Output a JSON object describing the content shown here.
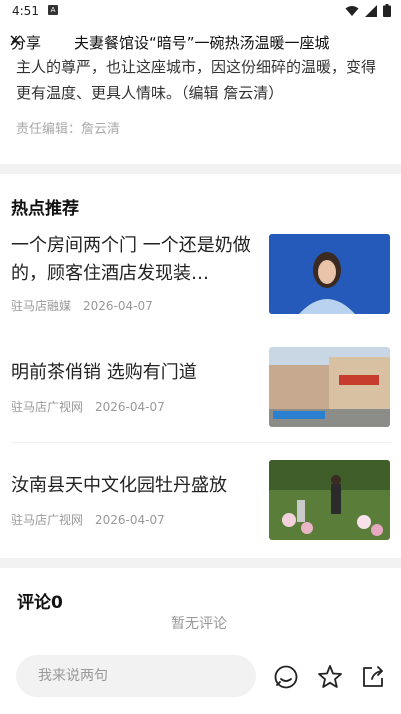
{
  "status": {
    "time": "4:51",
    "a_label": "A"
  },
  "header": {
    "share_label": "分享",
    "close_glyph": "×",
    "title": "夫妻餐馆设“暗号”一碗热汤温暖一座城"
  },
  "article": {
    "tail_line1": "主人的尊严，也让这座城市，因这份细碎的温暖，变得",
    "tail_line2": "更有温度、更具人情味。（编辑 詹云清）",
    "editor": "责任编辑：詹云清"
  },
  "hot": {
    "title": "热点推荐",
    "items": [
      {
        "title": "一个房间两个门 一个还是奶做的，顾客住酒店发现装…",
        "source": "驻马店融媒",
        "date": "2026-04-07"
      },
      {
        "title": "明前茶俏销 选购有门道",
        "source": "驻马店广视网",
        "date": "2026-04-07"
      },
      {
        "title": "汝南县天中文化园牡丹盛放",
        "source": "驻马店广视网",
        "date": "2026-04-07"
      }
    ]
  },
  "comments": {
    "title": "评论0",
    "empty_text": "暂无评论"
  },
  "bottom": {
    "input_placeholder": "我来说两句"
  },
  "colors": {
    "accent": "#1a6fd6",
    "muted": "#999999",
    "band": "#f2f2f2"
  }
}
